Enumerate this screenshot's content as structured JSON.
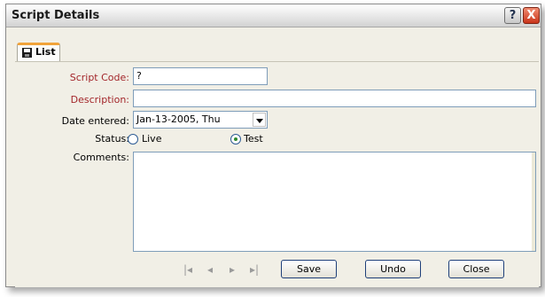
{
  "window": {
    "title": "Script Details",
    "help_label": "?",
    "close_label": "X"
  },
  "tab": {
    "label": "List",
    "icon": "floppy-disk-icon"
  },
  "form": {
    "script_code": {
      "label": "Script Code:",
      "value": "?"
    },
    "description": {
      "label": "Description:",
      "value": ""
    },
    "date_entered": {
      "label": "Date entered:",
      "value": "Jan-13-2005, Thu"
    },
    "status": {
      "label": "Status:",
      "options": [
        {
          "label": "Live",
          "checked": false
        },
        {
          "label": "Test",
          "checked": true
        }
      ]
    },
    "comments": {
      "label": "Comments:",
      "value": ""
    }
  },
  "nav": {
    "first_icon": "first-record-icon",
    "prev_icon": "previous-record-icon",
    "next_icon": "next-record-icon",
    "last_icon": "last-record-icon"
  },
  "buttons": {
    "save": "Save",
    "undo": "Undo",
    "close": "Close"
  },
  "colors": {
    "required_label": "#a3262a",
    "tab_accent": "#f1a33a",
    "button_border": "#1e3f79",
    "radio_check": "#2d8a2d"
  }
}
